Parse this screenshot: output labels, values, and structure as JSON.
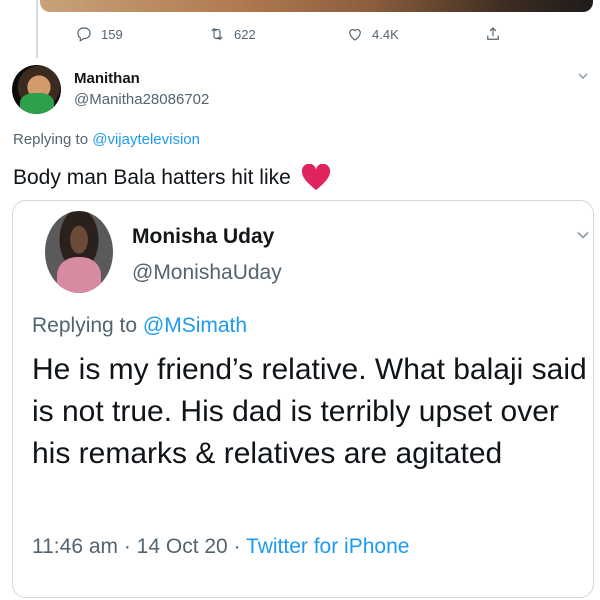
{
  "previous_tweet": {
    "reply_count": "159",
    "retweet_count": "622",
    "like_count": "4.4K"
  },
  "tweet": {
    "author_name": "Manithan",
    "author_handle": "@Manitha28086702",
    "replying_prefix": "Replying to ",
    "replying_to": "@vijaytelevision",
    "text": "Body man Bala hatters hit like",
    "emoji": "heart-icon"
  },
  "quoted_tweet": {
    "author_name": "Monisha Uday",
    "author_handle": "@MonishaUday",
    "replying_prefix": "Replying to ",
    "replying_to": "@MSimath",
    "text": "He is my friend’s relative. What balaji said is not true. His dad is terribly upset over his remarks & relatives are agitated",
    "time": "11:46 am",
    "sep1": " · ",
    "date": "14 Oct 20",
    "sep2": " · ",
    "source": "Twitter for iPhone"
  },
  "colors": {
    "link": "#1d9bf0",
    "muted": "#536471",
    "heart": "#e0245e"
  }
}
